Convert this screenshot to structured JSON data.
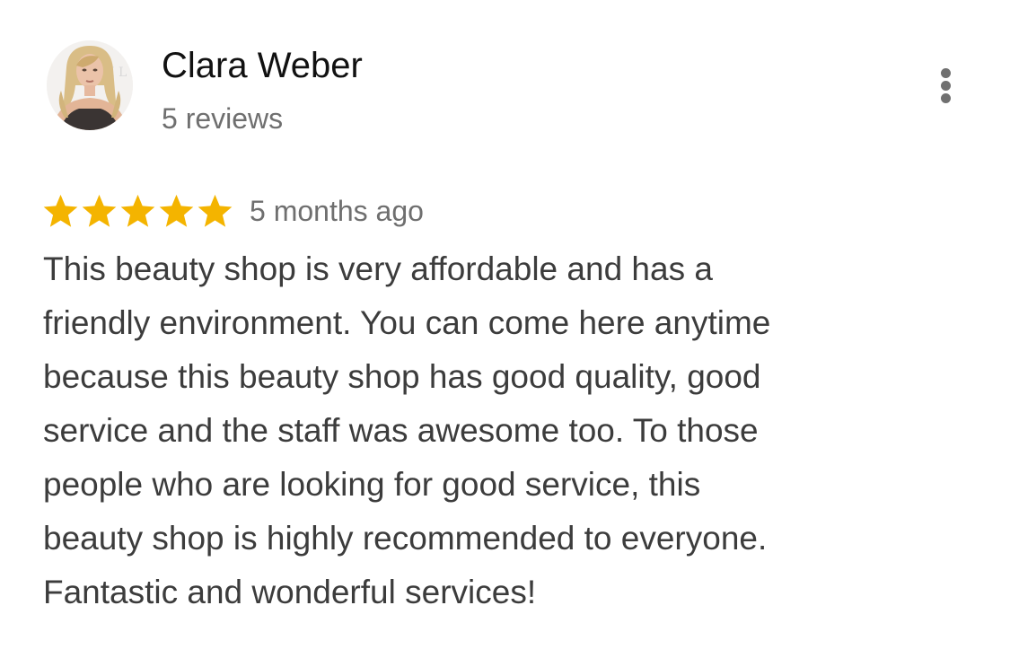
{
  "reviewer": {
    "name": "Clara Weber",
    "review_count": "5 reviews"
  },
  "menu": {
    "icon": "more-vert-icon"
  },
  "review": {
    "rating": 5,
    "rating_max": 5,
    "star_color": "#F4B400",
    "date": "5 months ago",
    "lines": [
      "This beauty shop is very affordable and has a",
      "friendly environment. You can come here anytime",
      "because this beauty shop has good quality, good",
      "service and the staff was awesome too. To those",
      "people who are looking for good service, this",
      "beauty shop is highly recommended to everyone.",
      "Fantastic and wonderful services!"
    ]
  }
}
